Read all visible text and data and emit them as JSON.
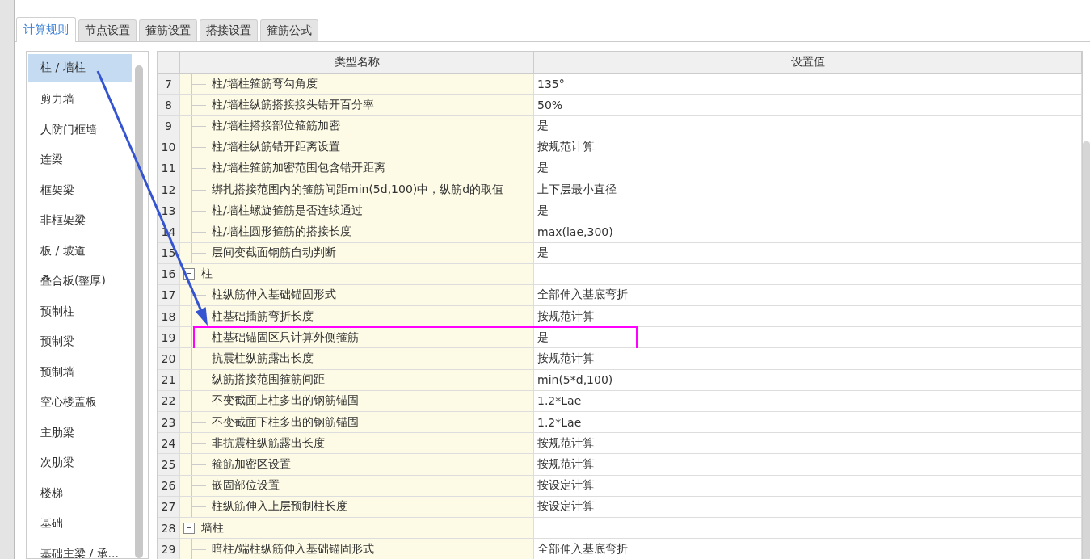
{
  "tabs": [
    {
      "label": "计算规则",
      "selected": true
    },
    {
      "label": "节点设置",
      "selected": false
    },
    {
      "label": "箍筋设置",
      "selected": false
    },
    {
      "label": "搭接设置",
      "selected": false
    },
    {
      "label": "箍筋公式",
      "selected": false
    }
  ],
  "sidebar": {
    "items": [
      {
        "label": "柱 / 墙柱",
        "selected": true
      },
      {
        "label": "剪力墙",
        "selected": false
      },
      {
        "label": "人防门框墙",
        "selected": false
      },
      {
        "label": "连梁",
        "selected": false
      },
      {
        "label": "框架梁",
        "selected": false
      },
      {
        "label": "非框架梁",
        "selected": false
      },
      {
        "label": "板 / 坡道",
        "selected": false
      },
      {
        "label": "叠合板(整厚)",
        "selected": false
      },
      {
        "label": "预制柱",
        "selected": false
      },
      {
        "label": "预制梁",
        "selected": false
      },
      {
        "label": "预制墙",
        "selected": false
      },
      {
        "label": "空心楼盖板",
        "selected": false
      },
      {
        "label": "主肋梁",
        "selected": false
      },
      {
        "label": "次肋梁",
        "selected": false
      },
      {
        "label": "楼梯",
        "selected": false
      },
      {
        "label": "基础",
        "selected": false
      },
      {
        "label": "基础主梁 / 承...",
        "selected": false
      }
    ]
  },
  "table": {
    "columns": [
      "类型名称",
      "设置值"
    ],
    "rows": [
      {
        "kind": "item",
        "index": "7",
        "name": "柱/墙柱箍筋弯勾角度",
        "value": "135°",
        "highlighted": false
      },
      {
        "kind": "item",
        "index": "8",
        "name": "柱/墙柱纵筋搭接接头错开百分率",
        "value": "50%",
        "highlighted": false
      },
      {
        "kind": "item",
        "index": "9",
        "name": "柱/墙柱搭接部位箍筋加密",
        "value": "是",
        "highlighted": false
      },
      {
        "kind": "item",
        "index": "10",
        "name": "柱/墙柱纵筋错开距离设置",
        "value": "按规范计算",
        "highlighted": false
      },
      {
        "kind": "item",
        "index": "11",
        "name": "柱/墙柱箍筋加密范围包含错开距离",
        "value": "是",
        "highlighted": false
      },
      {
        "kind": "item",
        "index": "12",
        "name": "绑扎搭接范围内的箍筋间距min(5d,100)中，纵筋d的取值",
        "value": "上下层最小直径",
        "highlighted": false
      },
      {
        "kind": "item",
        "index": "13",
        "name": "柱/墙柱螺旋箍筋是否连续通过",
        "value": "是",
        "highlighted": false
      },
      {
        "kind": "item",
        "index": "14",
        "name": "柱/墙柱圆形箍筋的搭接长度",
        "value": "max(lae,300)",
        "highlighted": false
      },
      {
        "kind": "item",
        "index": "15",
        "name": "层间变截面钢筋自动判断",
        "value": "是",
        "highlighted": false
      },
      {
        "kind": "group",
        "index": "16",
        "name": "柱",
        "expanded": true
      },
      {
        "kind": "item",
        "index": "17",
        "name": "柱纵筋伸入基础锚固形式",
        "value": "全部伸入基底弯折",
        "highlighted": false
      },
      {
        "kind": "item",
        "index": "18",
        "name": "柱基础插筋弯折长度",
        "value": "按规范计算",
        "highlighted": false
      },
      {
        "kind": "item",
        "index": "19",
        "name": "柱基础锚固区只计算外侧箍筋",
        "value": "是",
        "highlighted": true
      },
      {
        "kind": "item",
        "index": "20",
        "name": "抗震柱纵筋露出长度",
        "value": "按规范计算",
        "highlighted": false
      },
      {
        "kind": "item",
        "index": "21",
        "name": "纵筋搭接范围箍筋间距",
        "value": "min(5*d,100)",
        "highlighted": false
      },
      {
        "kind": "item",
        "index": "22",
        "name": "不变截面上柱多出的钢筋锚固",
        "value": "1.2*Lae",
        "highlighted": false
      },
      {
        "kind": "item",
        "index": "23",
        "name": "不变截面下柱多出的钢筋锚固",
        "value": "1.2*Lae",
        "highlighted": false
      },
      {
        "kind": "item",
        "index": "24",
        "name": "非抗震柱纵筋露出长度",
        "value": "按规范计算",
        "highlighted": false
      },
      {
        "kind": "item",
        "index": "25",
        "name": "箍筋加密区设置",
        "value": "按规范计算",
        "highlighted": false
      },
      {
        "kind": "item",
        "index": "26",
        "name": "嵌固部位设置",
        "value": "按设定计算",
        "highlighted": false
      },
      {
        "kind": "item",
        "index": "27",
        "name": "柱纵筋伸入上层预制柱长度",
        "value": "按设定计算",
        "highlighted": false
      },
      {
        "kind": "group",
        "index": "28",
        "name": "墙柱",
        "expanded": true
      },
      {
        "kind": "item",
        "index": "29",
        "name": "暗柱/端柱纵筋伸入基础锚固形式",
        "value": "全部伸入基底弯折",
        "highlighted": false
      }
    ]
  }
}
